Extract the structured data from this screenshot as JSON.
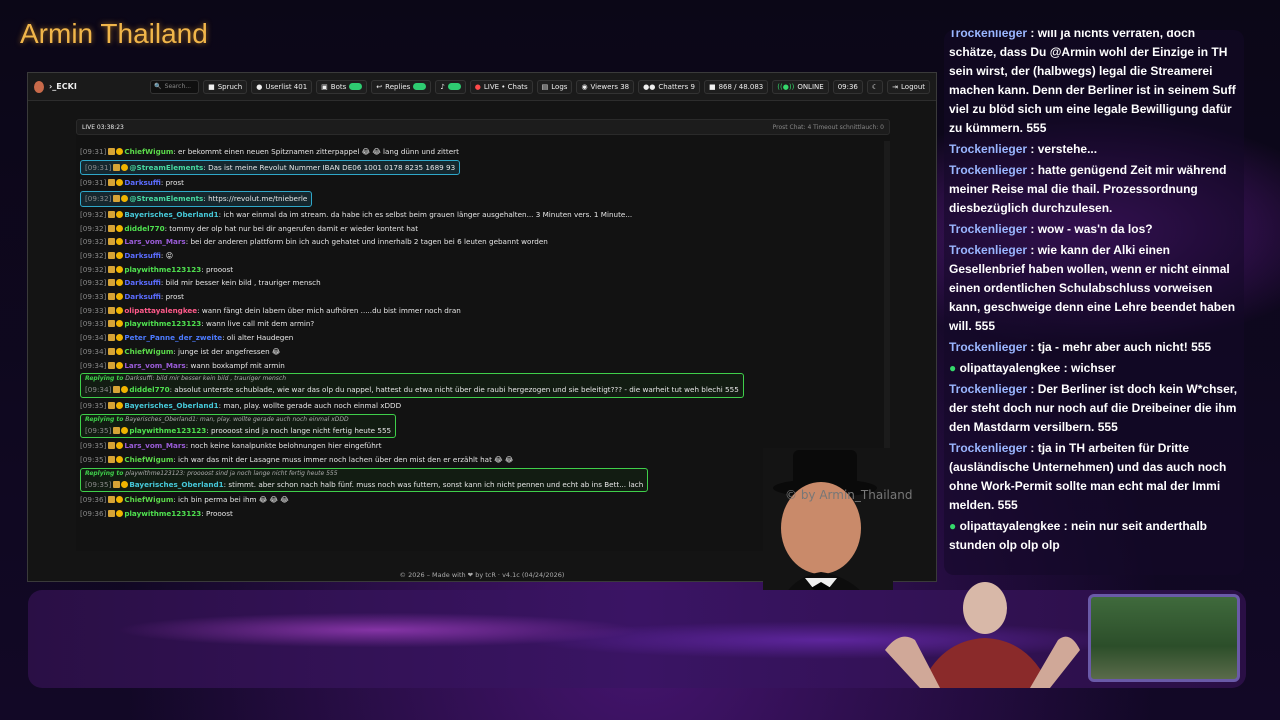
{
  "stream_title": "Armin Thailand",
  "watermark": "© by Armin_Thailand",
  "app": {
    "brand": "›_ECKI",
    "search_placeholder": "Search...",
    "buttons": {
      "spruch": "Spruch",
      "userlist": "Userlist 401",
      "bots": "Bots",
      "replies": "Replies",
      "live_chats": "LIVE • Chats",
      "logs": "Logs",
      "viewers": "Viewers 38",
      "chatters": "Chatters 9",
      "messages": "868 / 48.083",
      "online": "ONLINE",
      "clock": "09:36",
      "logout": "Logout"
    },
    "live_bar": {
      "left": "LIVE 03:38:23",
      "right": "Prost Chat: 4  Timeout schnittlauch: 0"
    },
    "footer": "© 2026 – Made with ❤ by tcR · v4.1c (04/24/2026)"
  },
  "chat": [
    {
      "time": "[09:31]",
      "user": "ChiefWigum",
      "color": "#5bd94a",
      "text": "er bekommt einen neuen Spitznamen zitterpappel 😂 😂 lang dünn und zittert"
    },
    {
      "time": "[09:31]",
      "user": "@StreamElements",
      "color": "#47d8a0",
      "text": "Das ist meine Revolut Nummer IBAN DE06 1001 0178 8235 1689 93",
      "highlight": true
    },
    {
      "time": "[09:31]",
      "user": "Darksuffi",
      "color": "#5b6cff",
      "text": "prost"
    },
    {
      "time": "[09:32]",
      "user": "@StreamElements",
      "color": "#47d8a0",
      "text": "https://revolut.me/tnieberle",
      "highlight": true
    },
    {
      "time": "[09:32]",
      "user": "Bayerisches_Oberland1",
      "color": "#46c8d8",
      "text": "ich war einmal da im stream. da habe ich es selbst beim grauen länger ausgehalten... 3 Minuten vers. 1 Minute..."
    },
    {
      "time": "[09:32]",
      "user": "diddel770",
      "color": "#4fe04f",
      "text": "tommy der olp hat nur bei dir angerufen damit er wieder kontent hat"
    },
    {
      "time": "[09:32]",
      "user": "Lars_vom_Mars",
      "color": "#9a5cd8",
      "text": "bei der anderen plattform bin ich auch gehatet und innerhalb 2 tagen bei 6 leuten gebannt worden"
    },
    {
      "time": "[09:32]",
      "user": "Darksuffi",
      "color": "#5b6cff",
      "text": "😝"
    },
    {
      "time": "[09:32]",
      "user": "playwithme123123",
      "color": "#4fe04f",
      "text": "prooost"
    },
    {
      "time": "[09:32]",
      "user": "Darksuffi",
      "color": "#5b6cff",
      "text": "bild mir besser kein bild , trauriger mensch"
    },
    {
      "time": "[09:33]",
      "user": "Darksuffi",
      "color": "#5b6cff",
      "text": "prost"
    },
    {
      "time": "[09:33]",
      "user": "olipattayalengkee",
      "color": "#ff5a8a",
      "text": "wann fängt dein labern über mich aufhören .....du bist immer noch dran"
    },
    {
      "time": "[09:33]",
      "user": "playwithme123123",
      "color": "#4fe04f",
      "text": "wann live call mit dem armin?"
    },
    {
      "time": "[09:34]",
      "user": "Peter_Panne_der_zweite",
      "color": "#4d7bff",
      "text": "oli alter Haudegen"
    },
    {
      "time": "[09:34]",
      "user": "ChiefWigum",
      "color": "#5bd94a",
      "text": "junge ist der angefressen 😂"
    },
    {
      "time": "[09:34]",
      "user": "Lars_vom_Mars",
      "color": "#9a5cd8",
      "text": "wann boxkampf mit armin"
    },
    {
      "time": "[09:34]",
      "user": "diddel770",
      "color": "#4fe04f",
      "text": "absolut unterste schublade, wie war das olp du nappel, hattest du etwa nicht über die raubi hergezogen und sie beleitigt??? - die warheit tut weh blechi 555",
      "reply_label": "Replying to",
      "reply_to": "Darksuffi: bild mir besser kein bild , trauriger mensch"
    },
    {
      "time": "[09:35]",
      "user": "Bayerisches_Oberland1",
      "color": "#46c8d8",
      "text": "man, play. wollte gerade auch noch einmal xDDD"
    },
    {
      "time": "[09:35]",
      "user": "playwithme123123",
      "color": "#4fe04f",
      "text": "proooost sind ja noch lange nicht fertig heute 555",
      "reply_label": "Replying to",
      "reply_to": "Bayerisches_Oberland1: man, play. wollte gerade auch noch einmal xDDD"
    },
    {
      "time": "[09:35]",
      "user": "Lars_vom_Mars",
      "color": "#9a5cd8",
      "text": "noch keine kanalpunkte belohnungen hier eingeführt"
    },
    {
      "time": "[09:35]",
      "user": "ChiefWigum",
      "color": "#5bd94a",
      "text": "ich war das mit der Lasagne muss immer noch lachen über den mist den er erzählt hat 😂 😂"
    },
    {
      "time": "[09:35]",
      "user": "Bayerisches_Oberland1",
      "color": "#46c8d8",
      "text": "stimmt. aber schon nach halb fünf. muss noch was futtern, sonst kann ich nicht pennen und echt ab ins Bett... lach",
      "reply_label": "Replying to",
      "reply_to": "playwithme123123: proooost sind ja noch lange nicht fertig heute 555"
    },
    {
      "time": "[09:36]",
      "user": "ChiefWigum",
      "color": "#5bd94a",
      "text": "ich bin perma bei ihm 😂 😂 😂"
    },
    {
      "time": "[09:36]",
      "user": "playwithme123123",
      "color": "#4fe04f",
      "text": "Prooost"
    }
  ],
  "overlay_chat": [
    {
      "user": "Trockenlieger",
      "text": ": will ja nichts verraten, doch schätze, dass Du @Armin wohl der Einzige in TH sein wirst, der (halbwegs) legal die Streamerei machen kann. Denn der Berliner ist in seinem Suff viel zu blöd sich um eine legale Bewilligung dafür zu kümmern. 555"
    },
    {
      "user": "Trockenlieger",
      "text": ": verstehe..."
    },
    {
      "user": "Trockenlieger",
      "text": ": hatte genügend Zeit mir während meiner Reise mal die thail. Prozessordnung diesbezüglich durchzulesen."
    },
    {
      "user": "Trockenlieger",
      "text": ": wow - was'n da los?"
    },
    {
      "user": "Trockenlieger",
      "text": ": wie kann der Alki einen Gesellenbrief haben wollen, wenn er nicht einmal einen ordentlichen Schulabschluss vorweisen kann, geschweige denn eine Lehre beendet haben will. 555"
    },
    {
      "user": "Trockenlieger",
      "text": ": tja - mehr aber auch nicht! 555"
    },
    {
      "user": "olipattayalengkee",
      "text": ": wichser",
      "badge": true
    },
    {
      "user": "Trockenlieger",
      "text": ": Der Berliner ist doch kein W*chser, der steht doch nur noch auf die Dreibeiner die ihm den Mastdarm versilbern. 555"
    },
    {
      "user": "Trockenlieger",
      "text": ": tja in TH arbeiten für Dritte (ausländische Unternehmen) und das auch noch ohne Work-Permit sollte man echt mal der Immi melden. 555"
    },
    {
      "user": "olipattayalengkee",
      "text": ": nein nur seit anderthalb stunden olp olp olp",
      "badge": true
    }
  ]
}
